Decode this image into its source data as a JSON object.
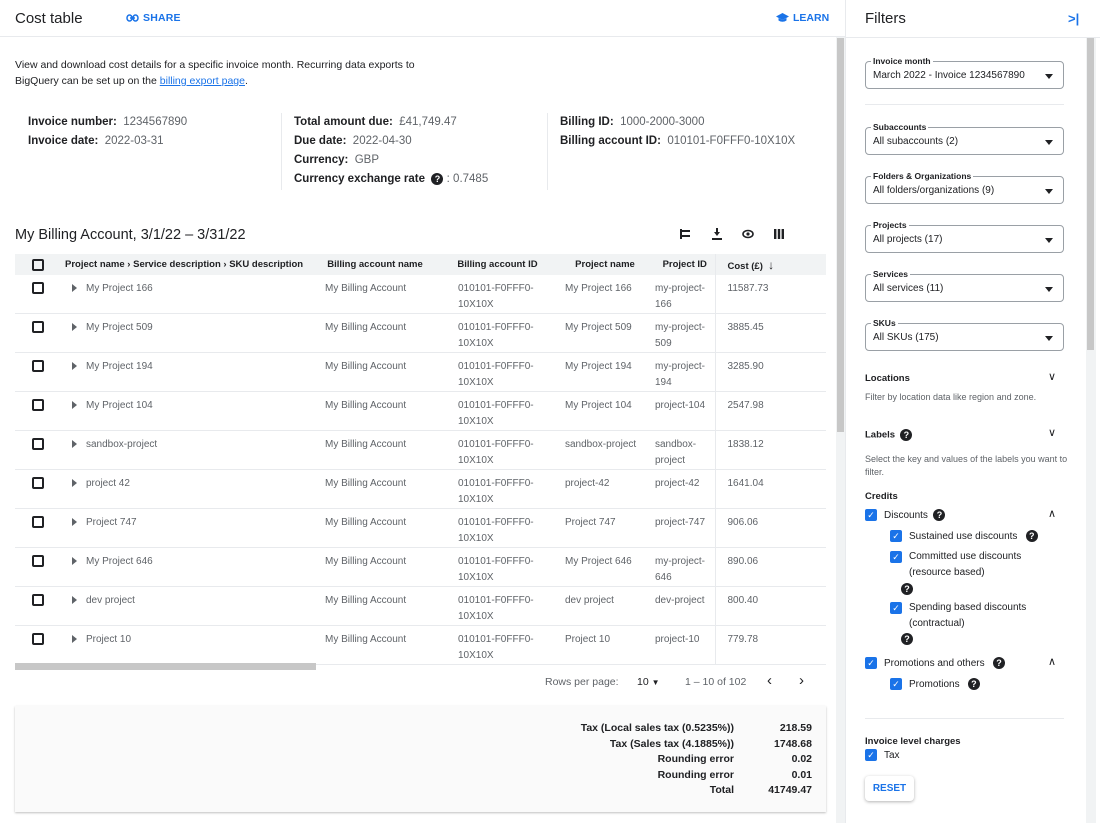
{
  "header": {
    "title": "Cost table",
    "share_label": "SHARE",
    "learn_label": "LEARN"
  },
  "intro": {
    "text": "View and download cost details for a specific invoice month. Recurring data exports to BigQuery can be set up on the ",
    "link": "billing export page",
    "end": "."
  },
  "summary": {
    "invoice_number_label": "Invoice number:",
    "invoice_number": "1234567890",
    "invoice_date_label": "Invoice date:",
    "invoice_date": "2022-03-31",
    "total_due_label": "Total amount due:",
    "total_due": "£41,749.47",
    "due_date_label": "Due date:",
    "due_date": "2022-04-30",
    "currency_label": "Currency:",
    "currency": "GBP",
    "exchange_label": "Currency exchange rate",
    "exchange_sep": ":",
    "exchange_rate": "0.7485",
    "billing_id_label": "Billing ID:",
    "billing_id": "1000-2000-3000",
    "billing_account_id_label": "Billing account ID:",
    "billing_account_id": "010101-F0FFF0-10X10X"
  },
  "table": {
    "title": "My Billing Account, 3/1/22 – 3/31/22",
    "toolbar_icons": [
      "group-by-icon",
      "download-icon",
      "visibility-icon",
      "columns-icon"
    ],
    "columns": [
      "Project name › Service description › SKU description",
      "Billing account name",
      "Billing account ID",
      "Project name",
      "Project ID",
      "Cost (£)"
    ],
    "rows": [
      {
        "name": "My Project 166",
        "account": "My Billing Account",
        "account_id": "010101-F0FFF0-10X10X",
        "project": "My Project 166",
        "project_id": "my-project-166",
        "cost": "11587.73"
      },
      {
        "name": "My Project 509",
        "account": "My Billing Account",
        "account_id": "010101-F0FFF0-10X10X",
        "project": "My Project 509",
        "project_id": "my-project-509",
        "cost": "3885.45"
      },
      {
        "name": "My Project 194",
        "account": "My Billing Account",
        "account_id": "010101-F0FFF0-10X10X",
        "project": "My Project 194",
        "project_id": "my-project-194",
        "cost": "3285.90"
      },
      {
        "name": "My Project 104",
        "account": "My Billing Account",
        "account_id": "010101-F0FFF0-10X10X",
        "project": "My Project 104",
        "project_id": "project-104",
        "cost": "2547.98"
      },
      {
        "name": "sandbox-project",
        "account": "My Billing Account",
        "account_id": "010101-F0FFF0-10X10X",
        "project": "sandbox-project",
        "project_id": "sandbox-project",
        "cost": "1838.12"
      },
      {
        "name": "project 42",
        "account": "My Billing Account",
        "account_id": "010101-F0FFF0-10X10X",
        "project": "project-42",
        "project_id": "project-42",
        "cost": "1641.04"
      },
      {
        "name": "Project 747",
        "account": "My Billing Account",
        "account_id": "010101-F0FFF0-10X10X",
        "project": "Project 747",
        "project_id": "project-747",
        "cost": "906.06"
      },
      {
        "name": "My Project 646",
        "account": "My Billing Account",
        "account_id": "010101-F0FFF0-10X10X",
        "project": "My Project 646",
        "project_id": "my-project-646",
        "cost": "890.06"
      },
      {
        "name": "dev project",
        "account": "My Billing Account",
        "account_id": "010101-F0FFF0-10X10X",
        "project": "dev project",
        "project_id": "dev-project",
        "cost": "800.40"
      },
      {
        "name": "Project 10",
        "account": "My Billing Account",
        "account_id": "010101-F0FFF0-10X10X",
        "project": "Project 10",
        "project_id": "project-10",
        "cost": "779.78"
      }
    ]
  },
  "pagination": {
    "rows_label": "Rows per page:",
    "rows_value": "10",
    "range": "1 – 10 of 102"
  },
  "totals": [
    {
      "label": "Tax (Local sales tax (0.5235%))",
      "value": "218.59"
    },
    {
      "label": "Tax (Sales tax (4.1885%))",
      "value": "1748.68"
    },
    {
      "label": "Rounding error",
      "value": "0.02"
    },
    {
      "label": "Rounding error",
      "value": "0.01"
    },
    {
      "label": "Total",
      "value": "41749.47"
    }
  ],
  "filters": {
    "title": "Filters",
    "selects": [
      {
        "label": "Invoice month",
        "value": "March 2022 - Invoice 1234567890"
      },
      {
        "label": "Subaccounts",
        "value": "All subaccounts (2)"
      },
      {
        "label": "Folders & Organizations",
        "value": "All folders/organizations (9)"
      },
      {
        "label": "Projects",
        "value": "All projects (17)"
      },
      {
        "label": "Services",
        "value": "All services (11)"
      },
      {
        "label": "SKUs",
        "value": "All SKUs (175)"
      }
    ],
    "locations": {
      "title": "Locations",
      "desc": "Filter by location data like region and zone."
    },
    "labels": {
      "title": "Labels",
      "desc": "Select the key and values of the labels you want to filter."
    },
    "credits": {
      "title": "Credits",
      "discounts": "Discounts",
      "sustained": "Sustained use discounts",
      "committed": "Committed use discounts (resource based)",
      "spending": "Spending based discounts (contractual)",
      "promotions_others": "Promotions and others",
      "promotions": "Promotions"
    },
    "invoice_charges": {
      "title": "Invoice level charges",
      "tax": "Tax"
    },
    "reset_label": "RESET"
  }
}
